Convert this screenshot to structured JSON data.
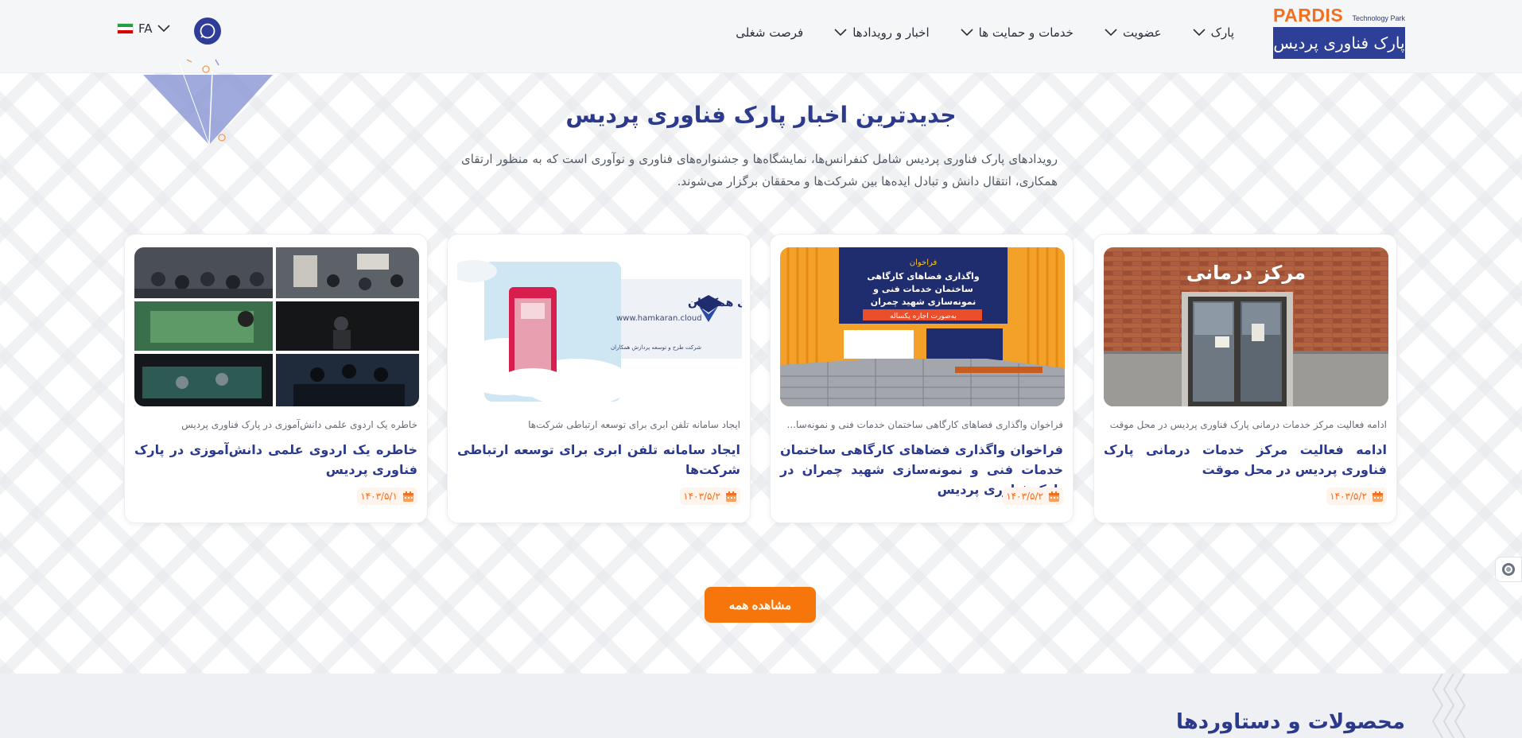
{
  "header": {
    "logo_word": "PARDIS",
    "logo_sub": "Technology Park",
    "logo_fa": "پارک فناوری پردیس",
    "nav": [
      {
        "label": "پارک",
        "has_dropdown": true
      },
      {
        "label": "عضویت",
        "has_dropdown": true
      },
      {
        "label": "خدمات و حمایت ها",
        "has_dropdown": true
      },
      {
        "label": "اخبار و رویدادها",
        "has_dropdown": true
      },
      {
        "label": "فرصت شغلی",
        "has_dropdown": false
      }
    ],
    "lang": "FA",
    "search_icon": "search-icon"
  },
  "news_section": {
    "title": "جدیدترین اخبار پارک فناوری پردیس",
    "description": "رویدادهای پارک فناوری پردیس شامل کنفرانس‌ها، نمایشگاه‌ها و جشنواره‌های فناوری و نوآوری است که به منظور ارتقای همکاری، انتقال دانش و تبادل ایده‌ها بین شرکت‌ها و محققان برگزار می‌شوند.",
    "cards": [
      {
        "summary": "ادامه فعالیت مرکز خدمات درمانی پارک فناوری پردیس در محل موقت",
        "title": "ادامه فعالیت مرکز خدمات درمانی پارک فناوری پردیس در محل موقت",
        "date": "۱۴۰۳/۵/۲",
        "image_text": "مرکز درمانی"
      },
      {
        "summary": "فراخوان واگذاری فضاهای کارگاهی ساختمان خدمات فنی و نمونه‌سا...",
        "title": "فراخوان واگذاری فضاهای کارگاهی ساختمان خدمات فنی و نمونه‌سازی شهید چمران در پارک فناوری پردیس",
        "date": "۱۴۰۳/۵/۲",
        "image_text": "فراخوان واگذاری فضاهای کارگاهی ساختمان خدمات فنی و نمونه‌سازی شهید چمران به‌صورت اجاره یکساله"
      },
      {
        "summary": "ایجاد سامانه تلفن ابری برای توسعه ارتباطی شرکت‌ها",
        "title": "ایجاد سامانه تلفن ابری برای توسعه ارتباطی شرکت‌ها",
        "date": "۱۴۰۳/۵/۲",
        "image_text": "تلفن ابری همکاران",
        "image_url_text": "www.hamkaran.cloud",
        "image_company": "شرکت طرح و توسعه پردازش همکاران"
      },
      {
        "summary": "خاطره یک اردوی علمی دانش‌آموزی در پارک فناوری پردیس",
        "title": "خاطره یک اردوی علمی دانش‌آموزی در پارک فناوری پردیس",
        "date": "۱۴۰۳/۵/۱"
      }
    ],
    "view_all": "مشاهده همه"
  },
  "bottom_section": {
    "title": "محصولات و دستاوردها"
  },
  "colors": {
    "brand_blue": "#2b3a8c",
    "brand_orange": "#f26f21",
    "button_orange": "#f7760b"
  }
}
